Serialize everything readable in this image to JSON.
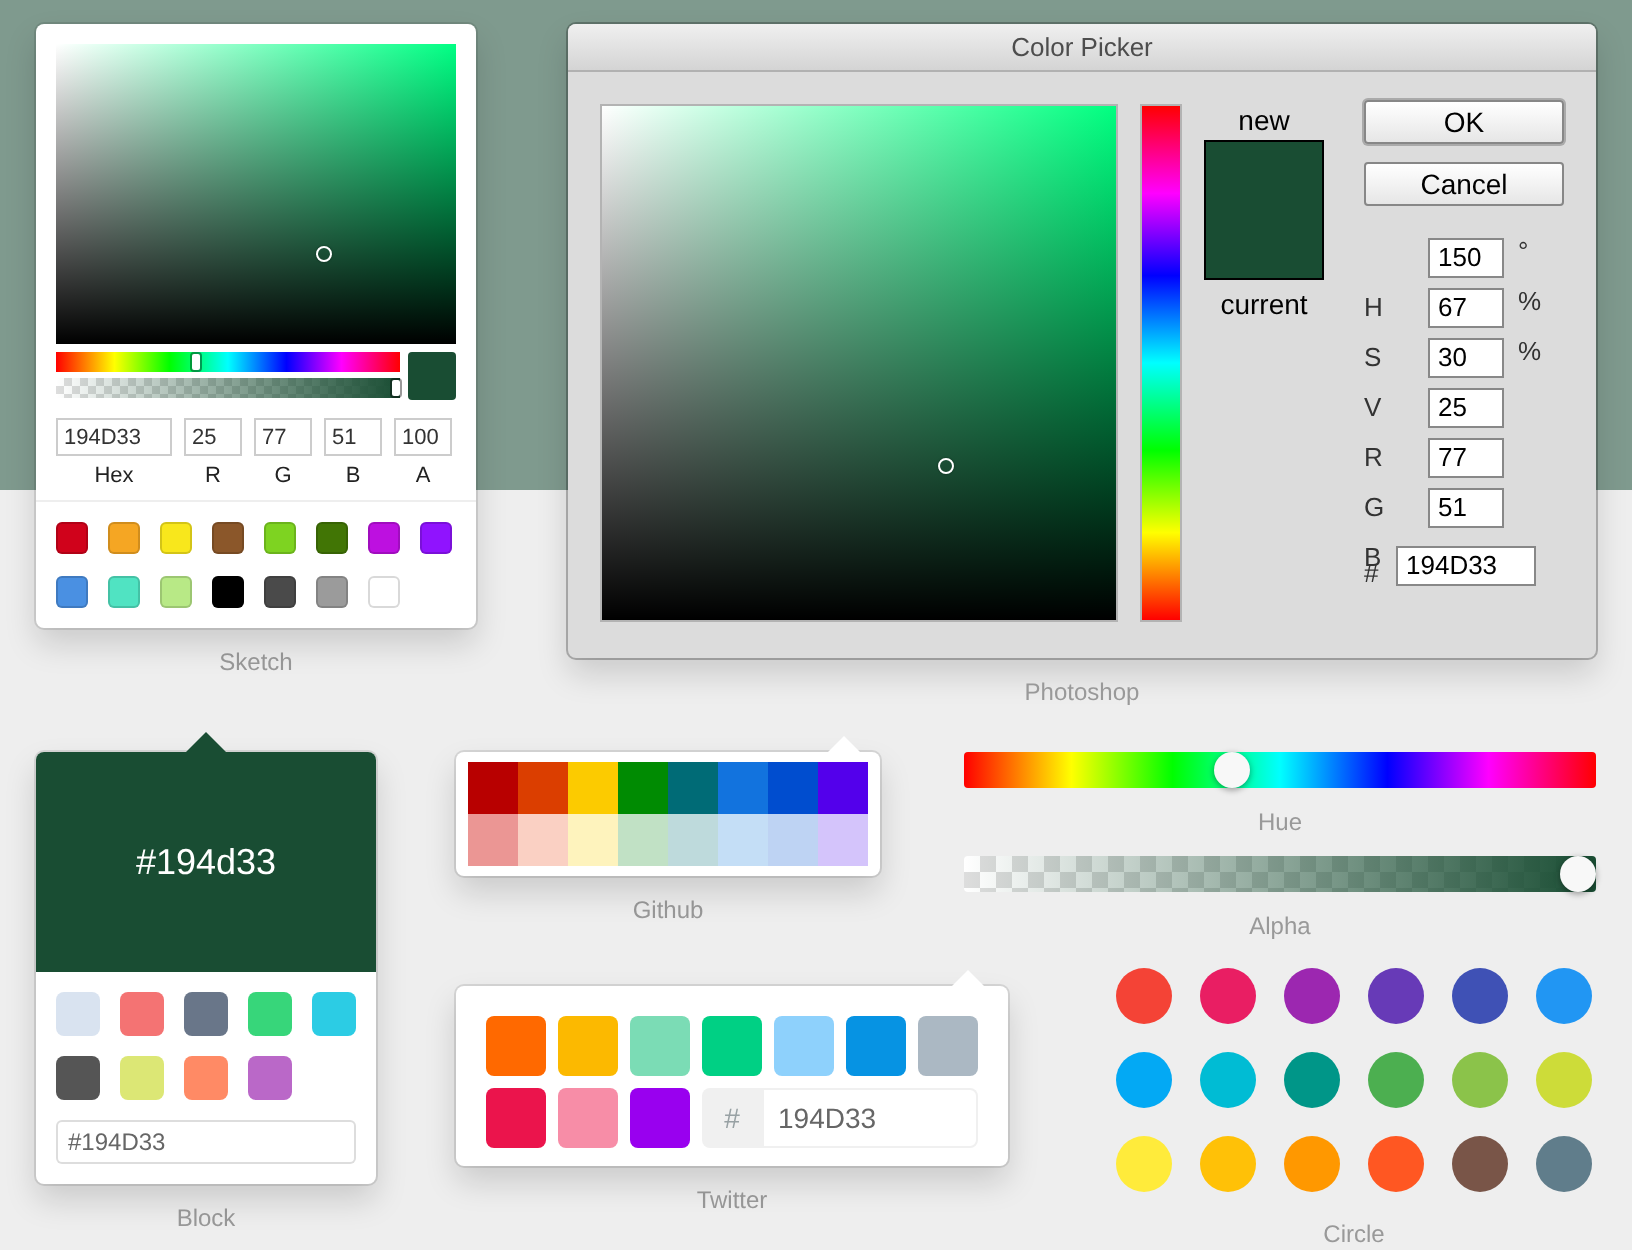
{
  "sketch": {
    "color": "#194d33",
    "hue": {
      "level": 0.42
    },
    "alpha": {
      "level": 1
    },
    "pointer": {
      "horizontal": {
        "level": 0.67
      },
      "vertical": {
        "level": 0.7
      }
    },
    "fields": [
      {
        "label": "Hex",
        "value": "194D33"
      },
      {
        "label": "R",
        "value": "25"
      },
      {
        "label": "G",
        "value": "77"
      },
      {
        "label": "B",
        "value": "51"
      },
      {
        "label": "A",
        "value": "100"
      }
    ],
    "presets": [
      {
        "color": "#d0021b"
      },
      {
        "color": "#f5a623"
      },
      {
        "color": "#f8e71c"
      },
      {
        "color": "#8b572a"
      },
      {
        "color": "#7ed321"
      },
      {
        "color": "#417505"
      },
      {
        "color": "#bd10e0"
      },
      {
        "color": "#9013fe"
      },
      {
        "color": "#4a90e2"
      },
      {
        "color": "#50e3c2"
      },
      {
        "color": "#b8e986"
      },
      {
        "color": "#000000"
      },
      {
        "color": "#4a4a4a"
      },
      {
        "color": "#9b9b9b"
      },
      {
        "color": "#ffffff"
      }
    ],
    "caption": "Sketch"
  },
  "photoshop": {
    "title": "Color Picker",
    "pointer": {
      "horizontal": {
        "level": 0.67
      },
      "vertical": {
        "level": 0.7
      }
    },
    "new_label": "new",
    "color": "#194d33",
    "current_label": "current",
    "buttons": [
      "OK",
      "Cancel"
    ],
    "fields": [
      {
        "value": "150",
        "unit": "°"
      },
      {
        "label": "H",
        "value": "67",
        "unit": "%"
      },
      {
        "label": "S",
        "value": "30",
        "unit": "%"
      },
      {
        "label": "V",
        "value": "25"
      },
      {
        "label": "R",
        "value": "77"
      },
      {
        "label": "G",
        "value": "51"
      },
      {
        "label": "B",
        "prefix": "#",
        "value": "194D33"
      }
    ],
    "caption": "Photoshop"
  },
  "block": {
    "hex": "#194d33",
    "swatches": [
      {
        "color": "#d9e3f0"
      },
      {
        "color": "#f47373"
      },
      {
        "color": "#697689"
      },
      {
        "color": "#37d67a"
      },
      {
        "color": "#2ccce4"
      },
      {
        "color": "#555555"
      },
      {
        "color": "#dce775"
      },
      {
        "color": "#ff8a65"
      },
      {
        "color": "#ba68c8"
      }
    ],
    "input": "#194D33",
    "caption": "Block"
  },
  "github": {
    "swatches": [
      {
        "color": "#b80000"
      },
      {
        "color": "#db3e00"
      },
      {
        "color": "#fccb00"
      },
      {
        "color": "#008b02"
      },
      {
        "color": "#006b76"
      },
      {
        "color": "#1273de"
      },
      {
        "color": "#004dcf"
      },
      {
        "color": "#5300eb"
      },
      {
        "color": "#eb9694"
      },
      {
        "color": "#fad0c3"
      },
      {
        "color": "#fef3bd"
      },
      {
        "color": "#c1e1c5"
      },
      {
        "color": "#bedadc"
      },
      {
        "color": "#c4def6"
      },
      {
        "color": "#bed3f3"
      },
      {
        "color": "#d4c4fb"
      }
    ],
    "caption": "Github"
  },
  "twitter": {
    "swatches": [
      {
        "color": "#ff6900"
      },
      {
        "color": "#fcb900"
      },
      {
        "color": "#7bdcb5"
      },
      {
        "color": "#00d084"
      },
      {
        "color": "#8ed1fc"
      },
      {
        "color": "#0693e3"
      },
      {
        "color": "#abb8c3"
      },
      {
        "color": "#eb144c"
      },
      {
        "color": "#f78da7"
      },
      {
        "color": "#9900ef"
      }
    ],
    "hash": "#",
    "input": "194D33",
    "caption": "Twitter"
  },
  "hue_slider": {
    "level": 0.42,
    "caption": "Hue"
  },
  "alpha_slider": {
    "level": 1,
    "color": "#194d33",
    "caption": "Alpha"
  },
  "circle": {
    "swatches": [
      {
        "color": "#f44336"
      },
      {
        "color": "#e91e63"
      },
      {
        "color": "#9c27b0"
      },
      {
        "color": "#673ab7"
      },
      {
        "color": "#3f51b5"
      },
      {
        "color": "#2196f3"
      },
      {
        "color": "#03a9f4"
      },
      {
        "color": "#00bcd4"
      },
      {
        "color": "#009688"
      },
      {
        "color": "#4caf50"
      },
      {
        "color": "#8bc34a"
      },
      {
        "color": "#cddc39"
      },
      {
        "color": "#ffeb3b"
      },
      {
        "color": "#ffc107"
      },
      {
        "color": "#ff9800"
      },
      {
        "color": "#ff5722"
      },
      {
        "color": "#795548"
      },
      {
        "color": "#607d8b"
      }
    ],
    "caption": "Circle"
  }
}
